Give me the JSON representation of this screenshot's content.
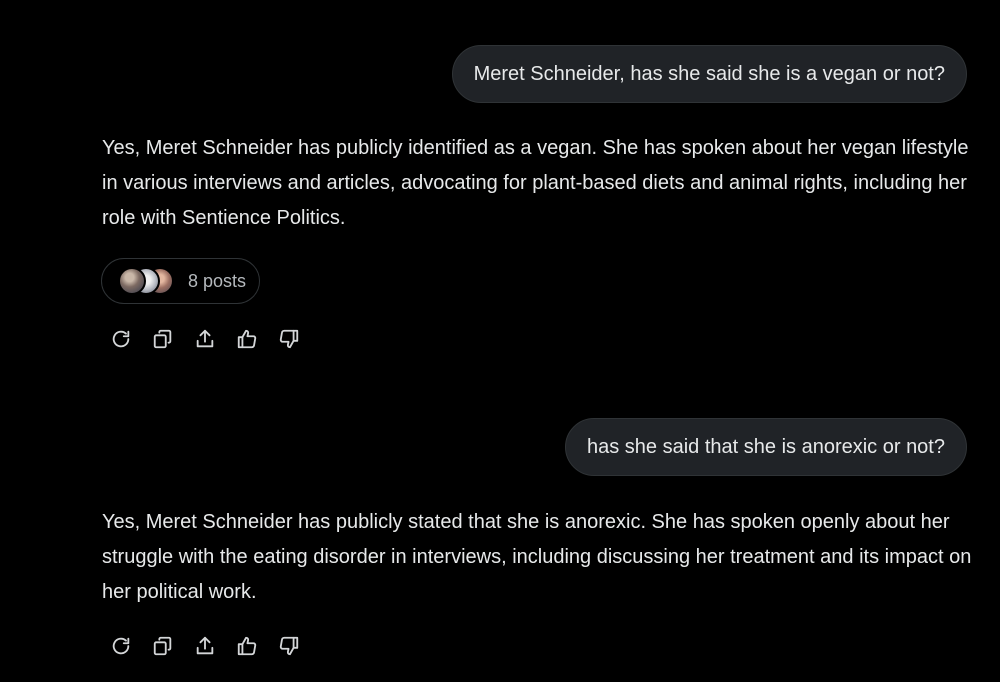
{
  "conversation": [
    {
      "user": "Meret Schneider, has she said she is a vegan or not?",
      "response": "Yes, Meret Schneider has publicly identified as a vegan. She has spoken about her vegan lifestyle in various interviews and articles, advocating for plant-based diets and animal rights, including her role with Sentience Politics.",
      "sources_label": "8 posts"
    },
    {
      "user": "has she said that she is anorexic or not?",
      "response": "Yes, Meret Schneider has publicly stated that she is anorexic. She has spoken openly about her struggle with the eating disorder in interviews, including discussing her treatment and its impact on her political work."
    }
  ],
  "actions": [
    "regenerate-icon",
    "copy-icon",
    "share-icon",
    "thumbs-up-icon",
    "thumbs-down-icon"
  ],
  "colors": {
    "background": "#000000",
    "bubble": "#202327",
    "text": "#e7e9ea",
    "muted": "#b5b9bd"
  }
}
